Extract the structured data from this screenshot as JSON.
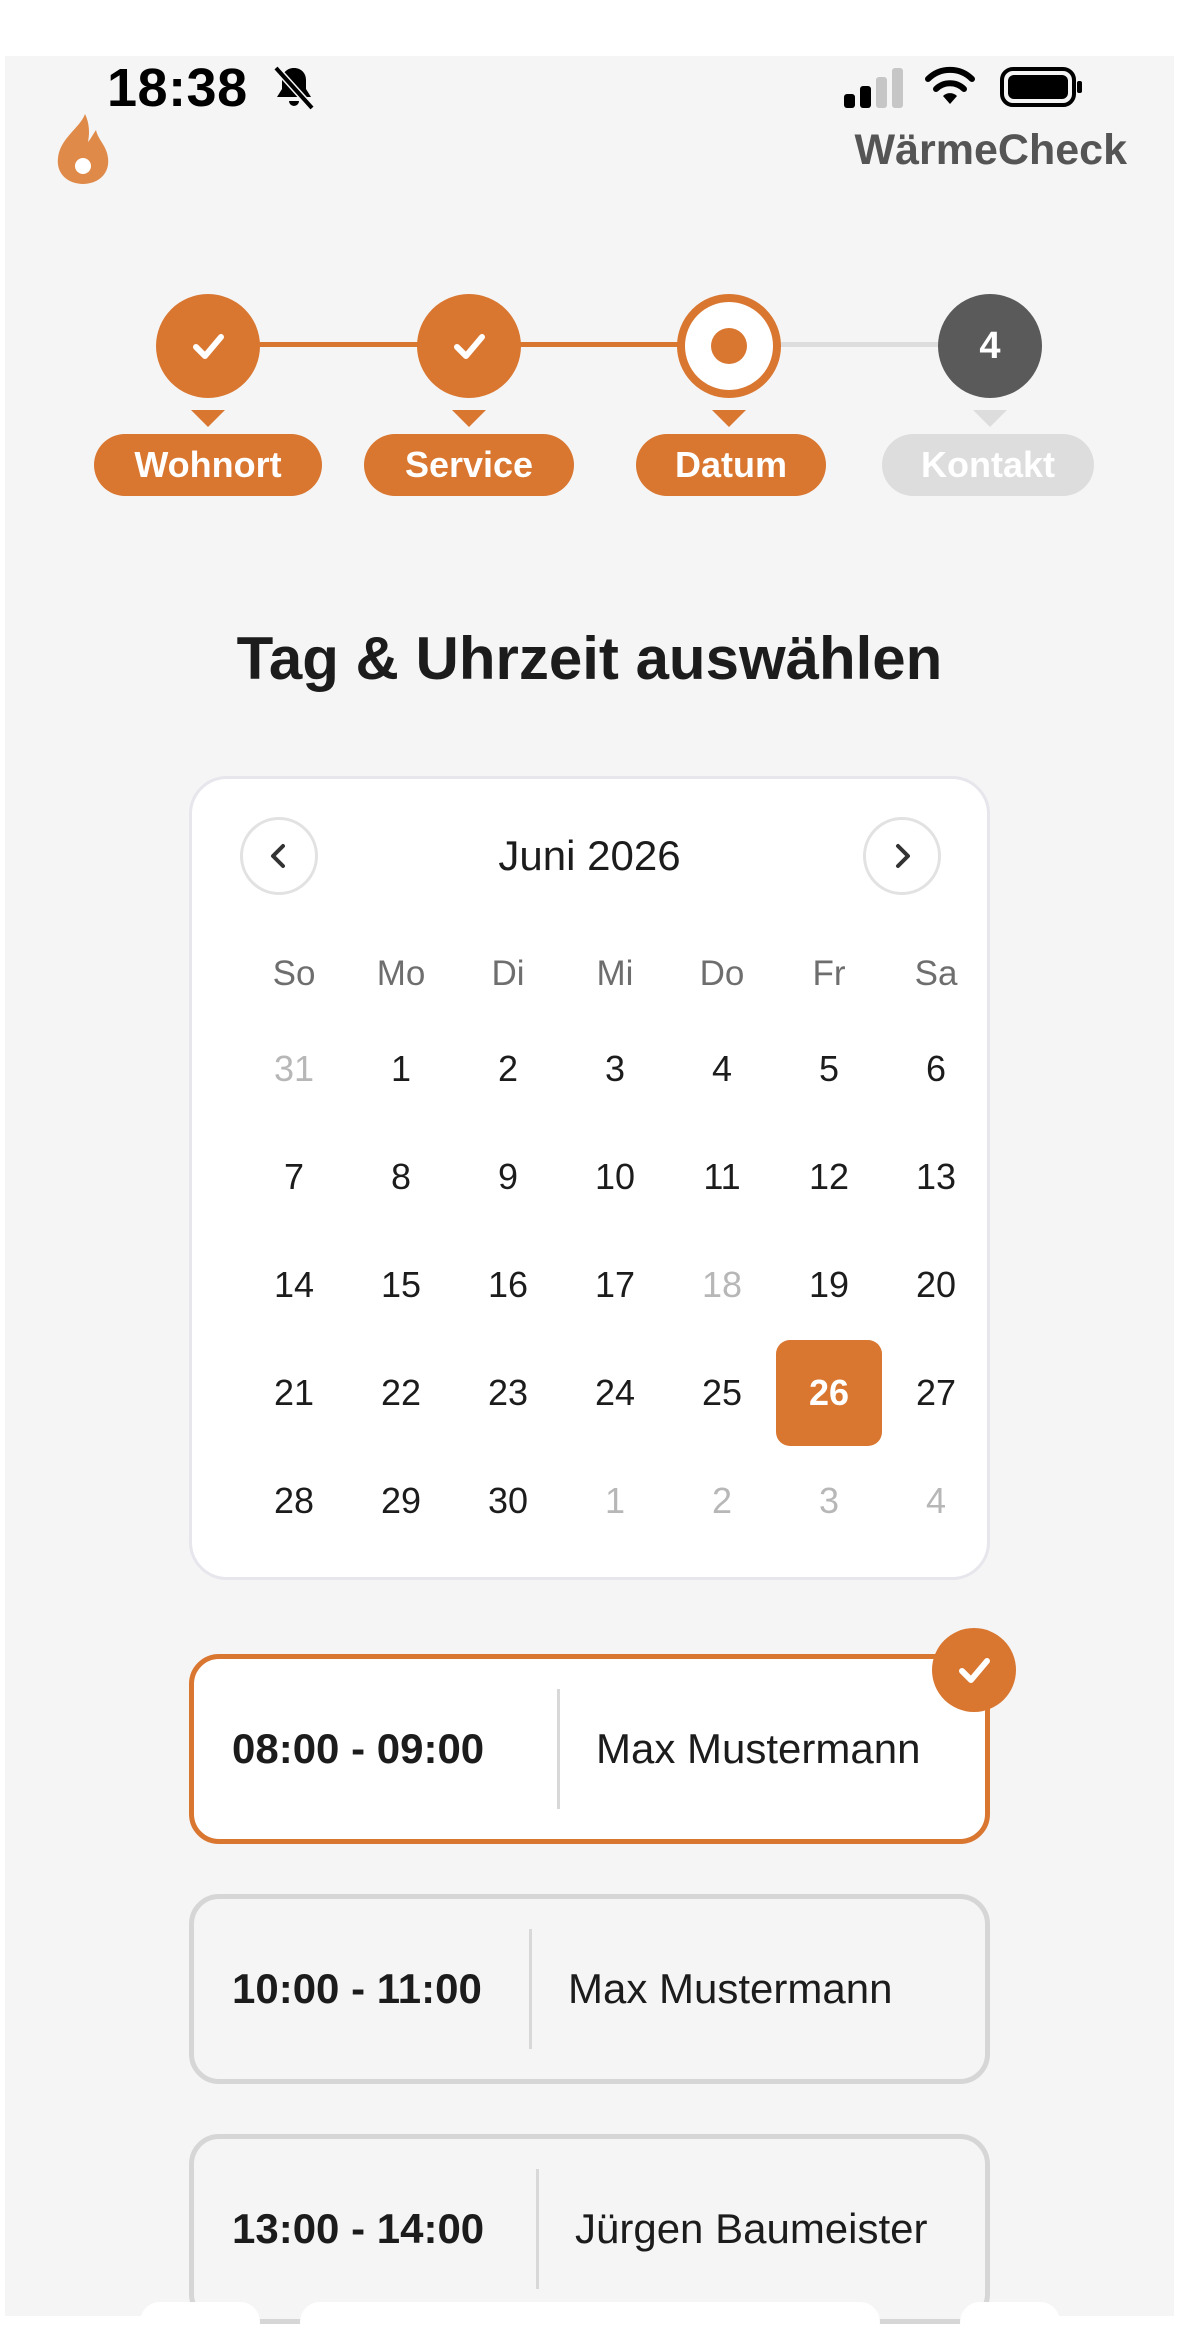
{
  "status_bar": {
    "time": "18:38"
  },
  "header": {
    "brand": "WärmeCheck"
  },
  "stepper": {
    "steps": [
      {
        "label": "Wohnort",
        "state": "completed"
      },
      {
        "label": "Service",
        "state": "completed"
      },
      {
        "label": "Datum",
        "state": "current"
      },
      {
        "label": "Kontakt",
        "state": "upcoming",
        "number": "4"
      }
    ]
  },
  "page_title": "Tag & Uhrzeit auswählen",
  "calendar": {
    "month_label": "Juni 2026",
    "weekdays": [
      "So",
      "Mo",
      "Di",
      "Mi",
      "Do",
      "Fr",
      "Sa"
    ],
    "weeks": [
      [
        "31",
        "1",
        "2",
        "3",
        "4",
        "5",
        "6"
      ],
      [
        "7",
        "8",
        "9",
        "10",
        "11",
        "12",
        "13"
      ],
      [
        "14",
        "15",
        "16",
        "17",
        "18",
        "19",
        "20"
      ],
      [
        "21",
        "22",
        "23",
        "24",
        "25",
        "26",
        "27"
      ],
      [
        "28",
        "29",
        "30",
        "1",
        "2",
        "3",
        "4"
      ]
    ],
    "muted_days": [
      "0-0",
      "2-4",
      "4-3",
      "4-4",
      "4-5",
      "4-6"
    ],
    "selected_day": "26"
  },
  "slots": [
    {
      "time": "08:00 - 09:00",
      "name": "Max Mustermann",
      "selected": true
    },
    {
      "time": "10:00 - 11:00",
      "name": "Max Mustermann",
      "selected": false
    },
    {
      "time": "13:00 - 14:00",
      "name": "Jürgen Baumeister",
      "selected": false
    }
  ],
  "colors": {
    "accent": "#d97630",
    "inactive": "#dddddd",
    "upcoming_circle": "#5a5a5a"
  }
}
